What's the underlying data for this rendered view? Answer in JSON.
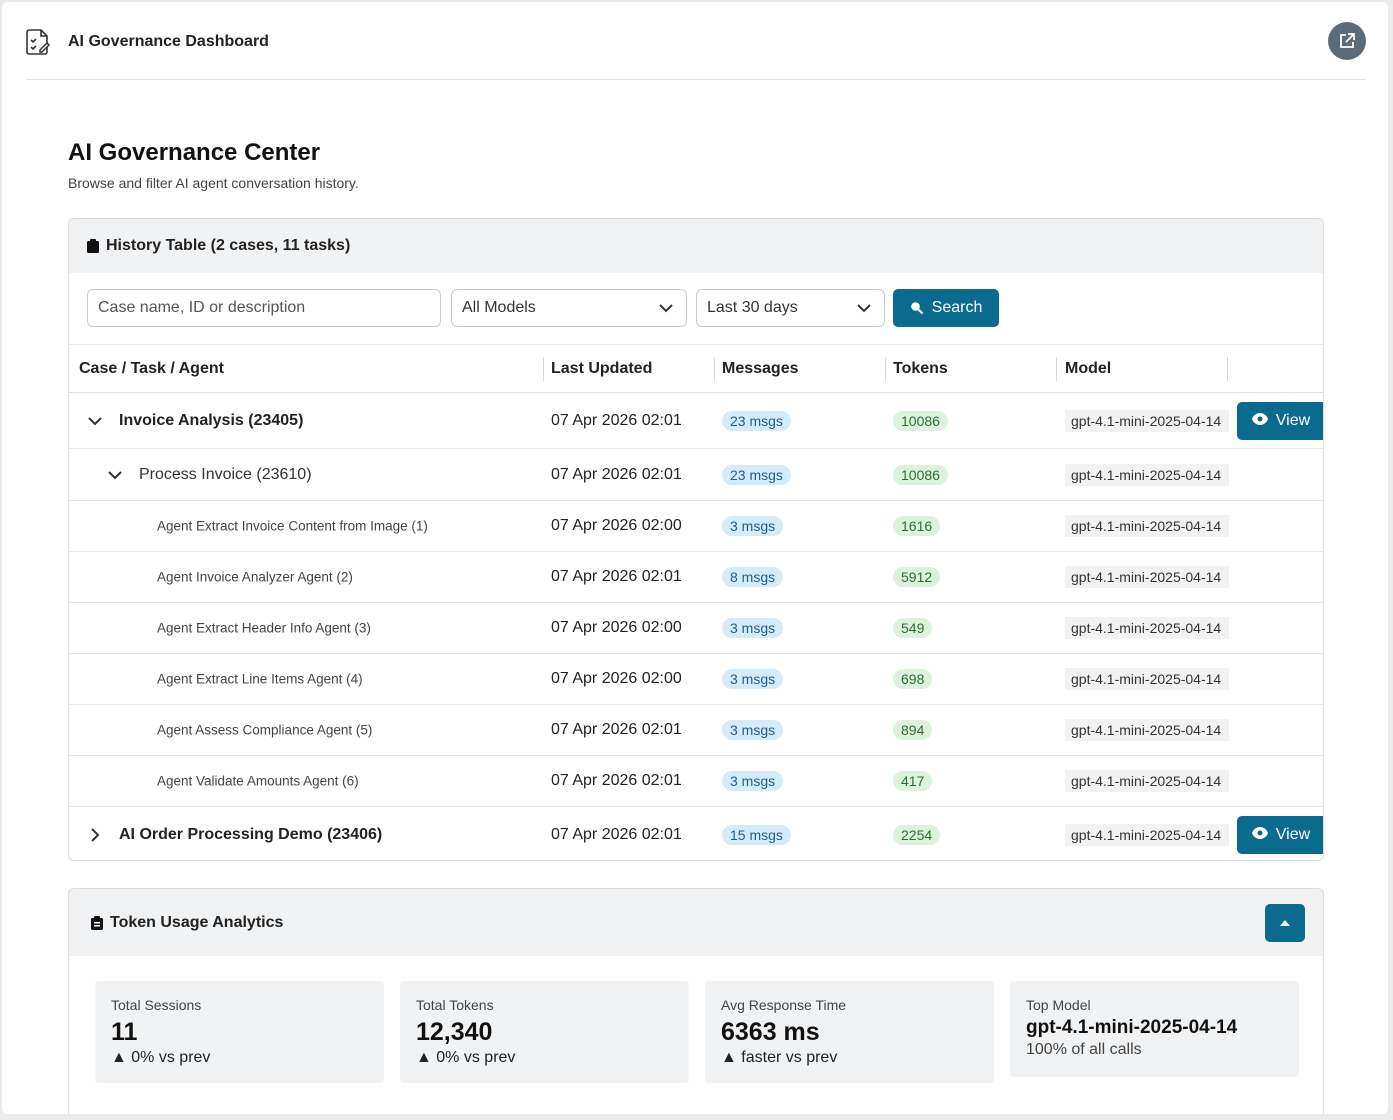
{
  "header": {
    "app_title": "AI Governance Dashboard",
    "icon": "document-check-icon",
    "action_icon": "external-link-icon"
  },
  "page": {
    "title": "AI Governance Center",
    "subtitle": "Browse and filter AI agent conversation history."
  },
  "history": {
    "title": "History Table (2 cases, 11 tasks)",
    "filters": {
      "search_placeholder": "Case name, ID or description",
      "model_select": "All Models",
      "range_select": "Last 30 days",
      "search_label": "Search"
    },
    "columns": [
      "Case / Task / Agent",
      "Last Updated",
      "Messages",
      "Tokens",
      "Model"
    ],
    "view_label": "View",
    "rows": [
      {
        "level": "case",
        "expanded": true,
        "name": "Invoice Analysis (23405)",
        "updated": "07 Apr 2026 02:01",
        "messages": "23 msgs",
        "tokens": "10086",
        "model": "gpt-4.1-mini-2025-04-14",
        "has_view": true
      },
      {
        "level": "task",
        "expanded": true,
        "name": "Process Invoice (23610)",
        "updated": "07 Apr 2026 02:01",
        "messages": "23 msgs",
        "tokens": "10086",
        "model": "gpt-4.1-mini-2025-04-14",
        "has_view": false
      },
      {
        "level": "agent",
        "name": "Agent Extract Invoice Content from Image (1)",
        "updated": "07 Apr 2026 02:00",
        "messages": "3 msgs",
        "tokens": "1616",
        "model": "gpt-4.1-mini-2025-04-14",
        "has_view": false
      },
      {
        "level": "agent",
        "name": "Agent Invoice Analyzer Agent (2)",
        "updated": "07 Apr 2026 02:01",
        "messages": "8 msgs",
        "tokens": "5912",
        "model": "gpt-4.1-mini-2025-04-14",
        "has_view": false
      },
      {
        "level": "agent",
        "name": "Agent Extract Header Info Agent (3)",
        "updated": "07 Apr 2026 02:00",
        "messages": "3 msgs",
        "tokens": "549",
        "model": "gpt-4.1-mini-2025-04-14",
        "has_view": false
      },
      {
        "level": "agent",
        "name": "Agent Extract Line Items Agent (4)",
        "updated": "07 Apr 2026 02:00",
        "messages": "3 msgs",
        "tokens": "698",
        "model": "gpt-4.1-mini-2025-04-14",
        "has_view": false
      },
      {
        "level": "agent",
        "name": "Agent Assess Compliance Agent (5)",
        "updated": "07 Apr 2026 02:01",
        "messages": "3 msgs",
        "tokens": "894",
        "model": "gpt-4.1-mini-2025-04-14",
        "has_view": false
      },
      {
        "level": "agent",
        "name": "Agent Validate Amounts Agent (6)",
        "updated": "07 Apr 2026 02:01",
        "messages": "3 msgs",
        "tokens": "417",
        "model": "gpt-4.1-mini-2025-04-14",
        "has_view": false
      },
      {
        "level": "case",
        "expanded": false,
        "name": "AI Order Processing Demo (23406)",
        "updated": "07 Apr 2026 02:01",
        "messages": "15 msgs",
        "tokens": "2254",
        "model": "gpt-4.1-mini-2025-04-14",
        "has_view": true
      }
    ]
  },
  "analytics": {
    "title": "Token Usage Analytics",
    "stats": [
      {
        "label": "Total Sessions",
        "value": "11",
        "delta": "▲ 0% vs prev"
      },
      {
        "label": "Total Tokens",
        "value": "12,340",
        "delta": "▲ 0% vs prev"
      },
      {
        "label": "Avg Response Time",
        "value": "6363 ms",
        "delta": "▲ faster vs prev"
      },
      {
        "label": "Top Model",
        "value": "gpt-4.1-mini-2025-04-14",
        "delta": "100% of all calls"
      }
    ]
  },
  "colors": {
    "accent": "#0a6b8f",
    "msgs_badge": "#d4ebfb",
    "tokens_badge": "#dcf2dc"
  }
}
